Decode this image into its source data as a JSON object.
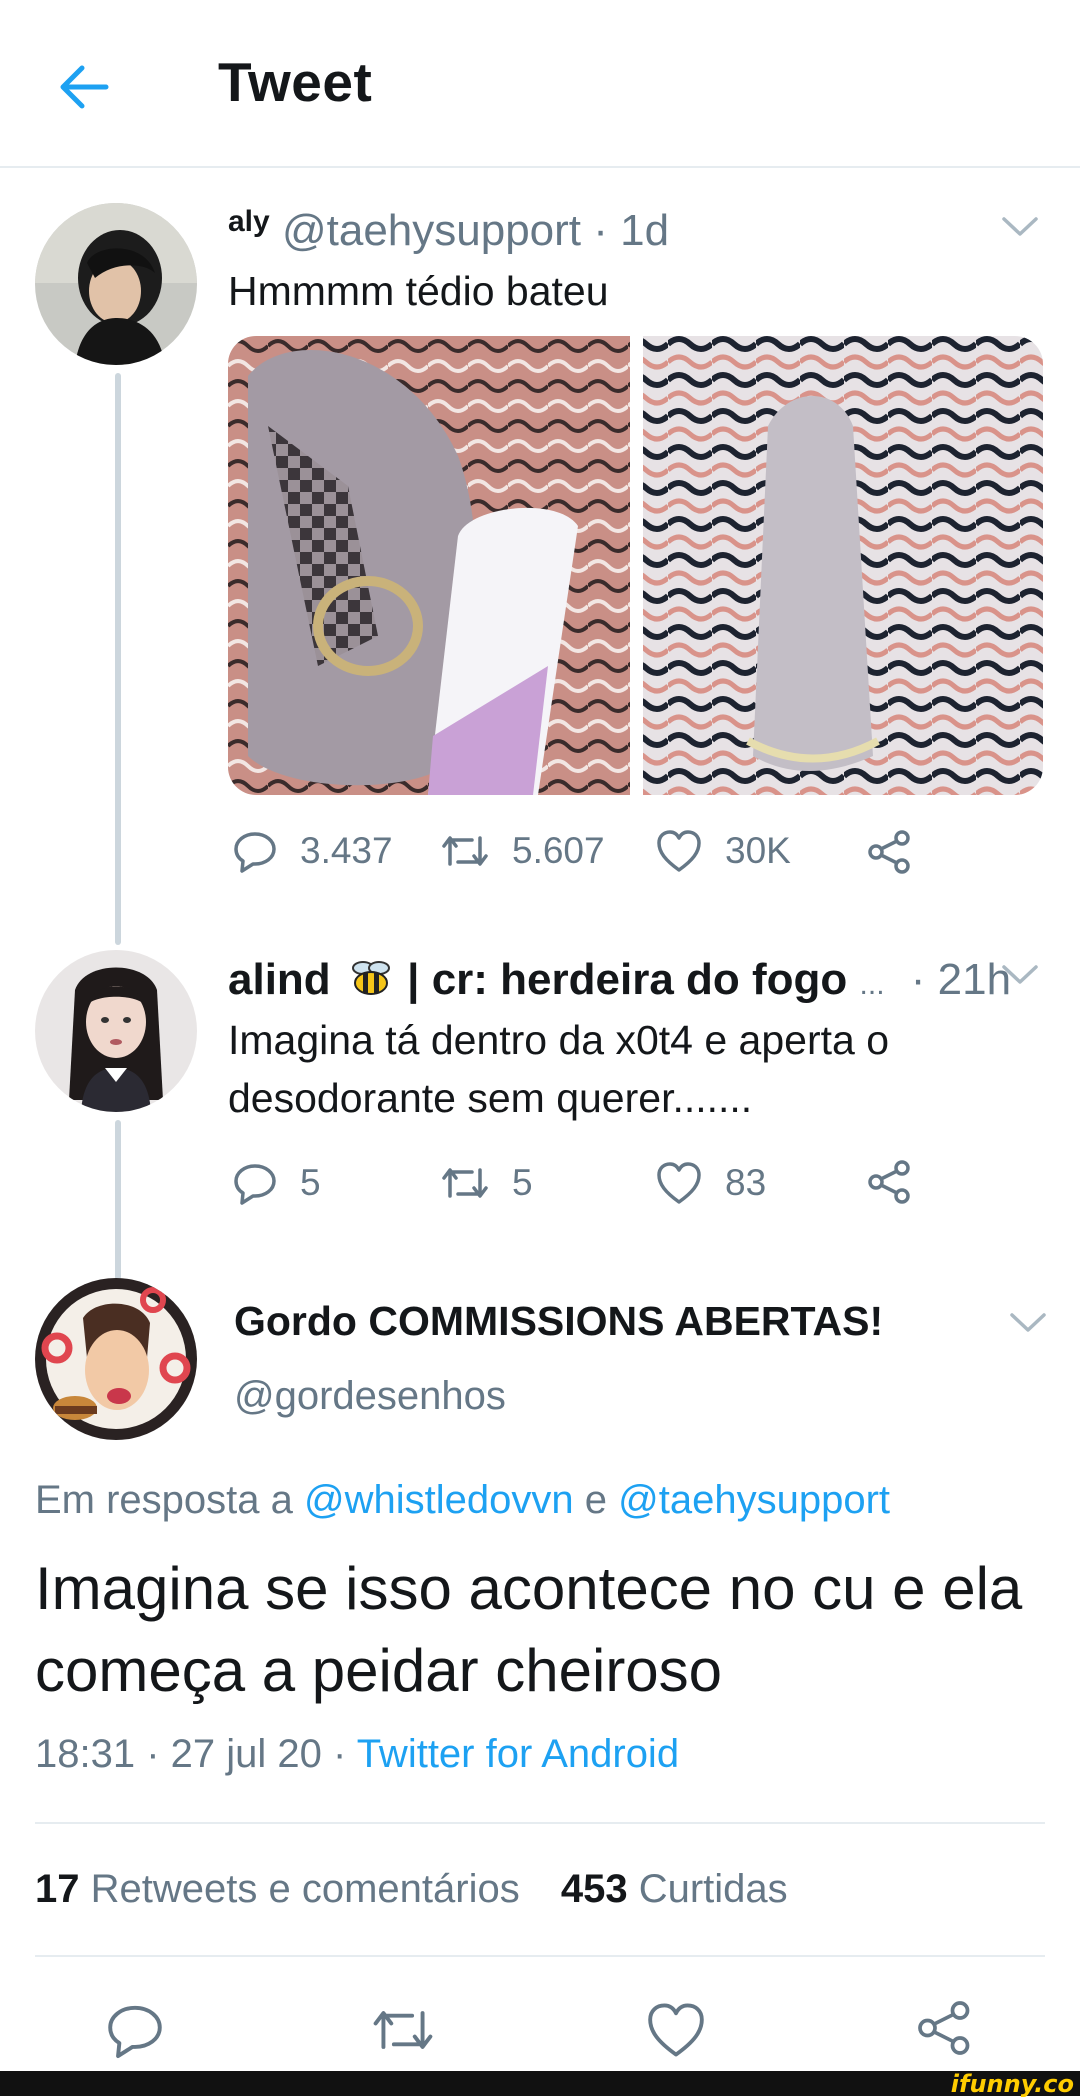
{
  "header": {
    "title": "Tweet"
  },
  "tweet1": {
    "name": "aly",
    "handle": "@taehysupport",
    "time": "· 1d",
    "text": "Hmmmm tédio bateu",
    "replies": "3.437",
    "retweets": "5.607",
    "likes": "30K"
  },
  "tweet2": {
    "name": "alind",
    "name_rest": "| cr: herdeira do fogo",
    "ellipsis": "...",
    "time": "· 21h",
    "text": "Imagina tá dentro da x0t4 e aperta o desodorante sem querer.......",
    "replies": "5",
    "retweets": "5",
    "likes": "83"
  },
  "main": {
    "name": "Gordo COMMISSIONS ABERTAS!",
    "handle": "@gordesenhos",
    "reply_prefix": "Em resposta a",
    "reply_user1": "@whistledovvn",
    "reply_and": "e",
    "reply_user2": "@taehysupport",
    "text": "Imagina se isso acontece no cu e ela começa a peidar cheiroso",
    "timestamp": "18:31 · 27 jul 20 ·",
    "source": "Twitter for Android",
    "retweets_count": "17",
    "retweets_label": "Retweets e comentários",
    "likes_count": "453",
    "likes_label": "Curtidas"
  },
  "watermark": "ifunny.co",
  "colors": {
    "accent": "#1da1f2",
    "secondary_text": "#657786",
    "divider": "#e6ecf0"
  },
  "icons": [
    "back-arrow-icon",
    "chevron-down-icon",
    "reply-icon",
    "retweet-icon",
    "like-icon",
    "share-icon",
    "bee-emoji-icon"
  ]
}
